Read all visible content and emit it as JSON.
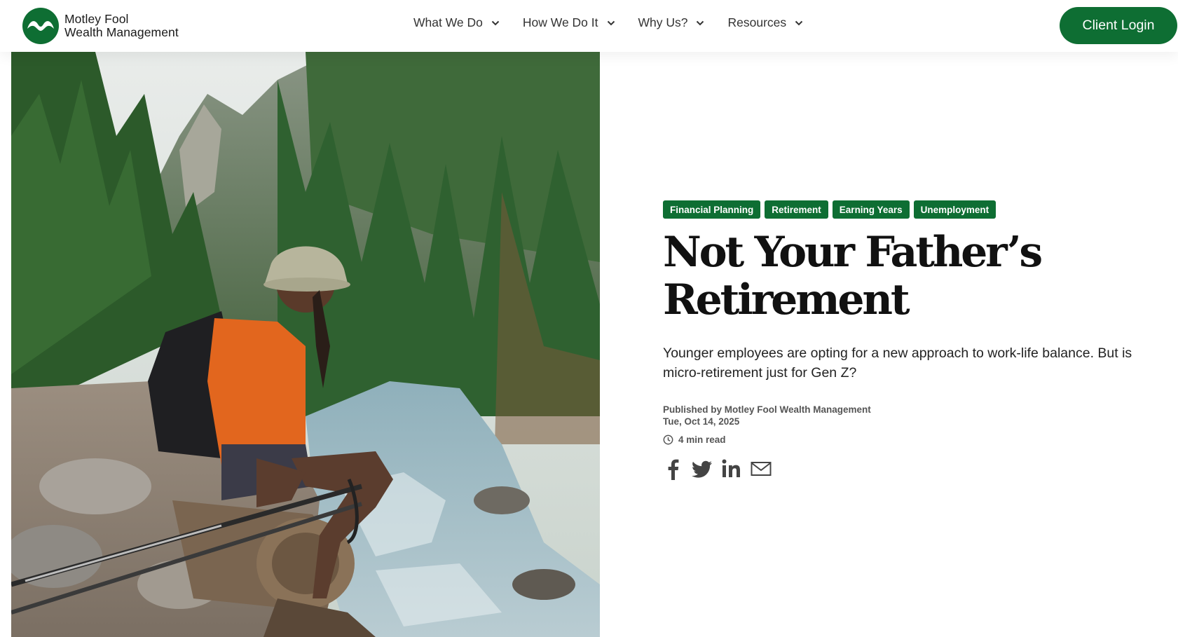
{
  "header": {
    "logo_line1": "Motley Fool",
    "logo_line2": "Wealth Management",
    "nav": [
      {
        "label": "What We Do"
      },
      {
        "label": "How We Do It"
      },
      {
        "label": "Why Us?"
      },
      {
        "label": "Resources"
      }
    ],
    "login_label": "Client Login"
  },
  "article": {
    "tags": [
      "Financial Planning",
      "Retirement",
      "Earning Years",
      "Unemployment"
    ],
    "title": "Not Your Father’s Retirement",
    "summary": "Younger employees are opting for a new approach to work-life balance. But is micro-retirement just for Gen Z?",
    "published_by": "Published by Motley Fool Wealth Management",
    "date": "Tue, Oct 14, 2025",
    "read_time": "4 min read",
    "share_icons": [
      "facebook-icon",
      "twitter-icon",
      "linkedin-icon",
      "email-icon"
    ]
  },
  "colors": {
    "brand_green": "#0e6e33",
    "text_dark": "#111111",
    "meta_gray": "#555555"
  }
}
